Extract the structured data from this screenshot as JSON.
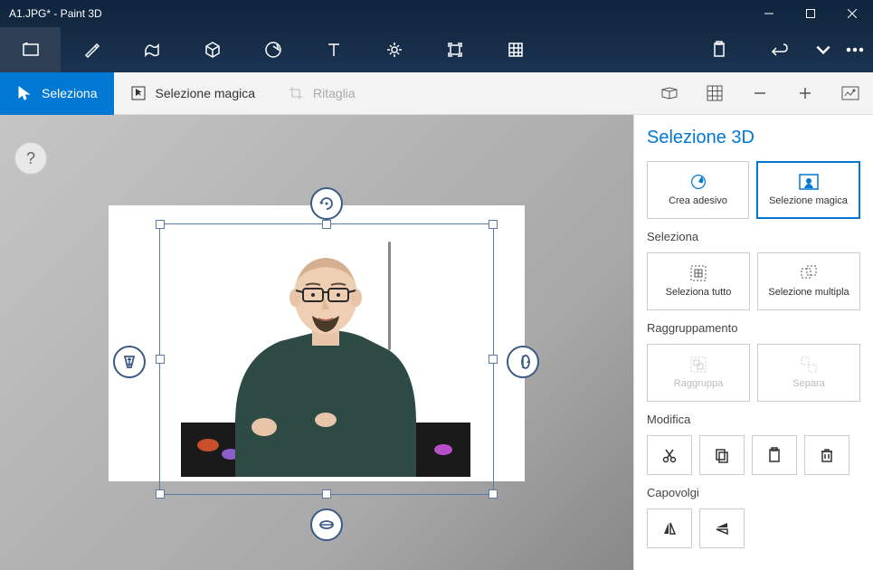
{
  "titlebar": {
    "title": "A1.JPG* - Paint 3D"
  },
  "sectoolbar": {
    "select_label": "Seleziona",
    "magic_select_label": "Selezione magica",
    "crop_label": "Ritaglia"
  },
  "sidepanel": {
    "title": "Selezione 3D",
    "create_sticker": "Crea adesivo",
    "magic_select": "Selezione magica",
    "select_section": "Seleziona",
    "select_all": "Seleziona tutto",
    "multi_select": "Selezione multipla",
    "group_section": "Raggruppamento",
    "group": "Raggruppa",
    "ungroup": "Separa",
    "edit_section": "Modifica",
    "flip_section": "Capovolgi"
  },
  "icons": {
    "help": "?",
    "minimize": "minimize",
    "maximize": "maximize",
    "close": "close"
  }
}
